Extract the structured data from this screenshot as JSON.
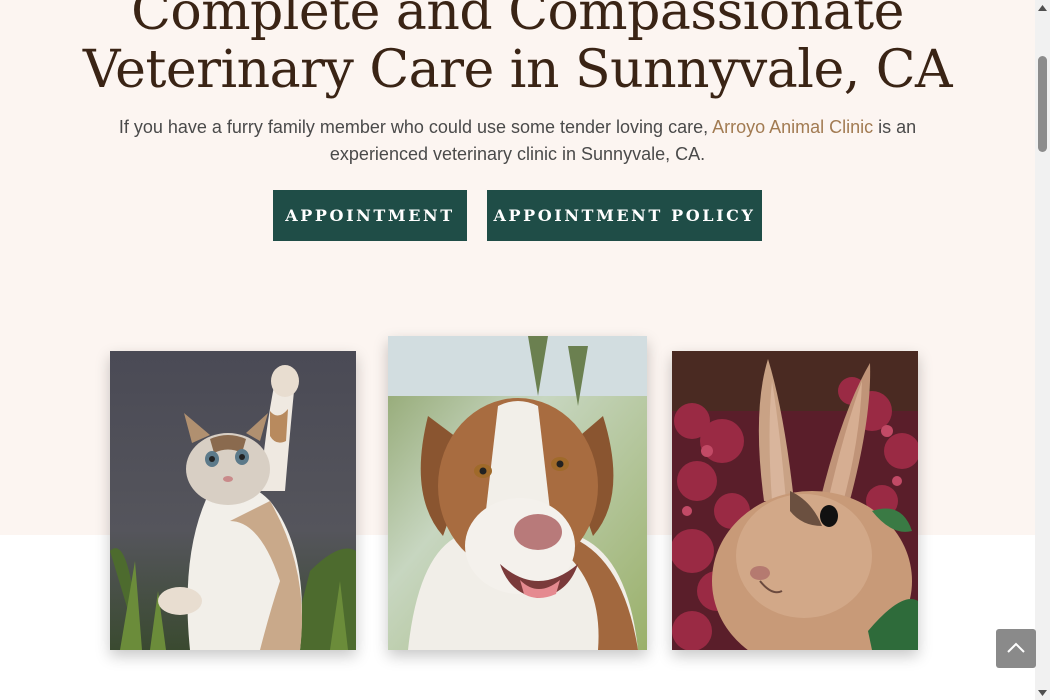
{
  "hero": {
    "heading_line1": "Complete and Compassionate",
    "heading_line2": "Veterinary Care in Sunnyvale, CA",
    "intro_before": "If you have a furry family member who could use some tender loving care, ",
    "intro_link": "Arroyo Animal Clinic",
    "intro_after": " is an experienced veterinary clinic in Sunnyvale, CA.",
    "buttons": [
      {
        "label": "APPOINTMENT"
      },
      {
        "label": "APPOINTMENT POLICY"
      }
    ]
  },
  "gallery": [
    {
      "subject": "cat"
    },
    {
      "subject": "dog"
    },
    {
      "subject": "rabbit"
    }
  ],
  "colors": {
    "hero_bg": "#fcf5f1",
    "heading": "#3a2415",
    "link": "#a27b52",
    "button_bg": "#1f4d47",
    "button_text": "#ffffff"
  },
  "icons": {
    "back_to_top": "chevron-up-icon",
    "scroll_up": "triangle-up-icon",
    "scroll_down": "triangle-down-icon"
  }
}
